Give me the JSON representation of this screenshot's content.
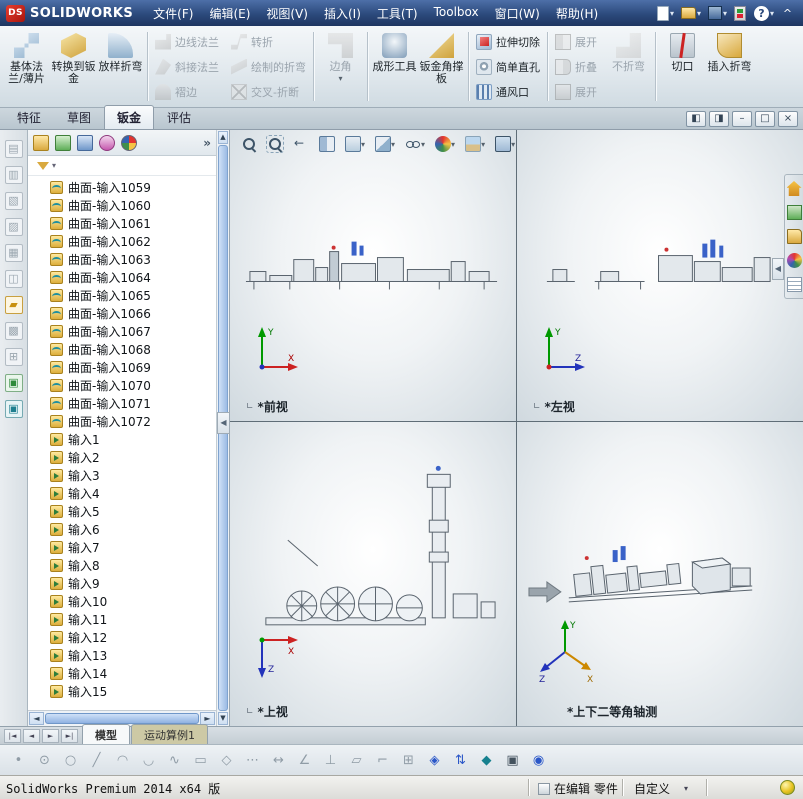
{
  "titlebar": {
    "logo_mark": "DS",
    "logo_text": "SOLIDWORKS",
    "menus": [
      {
        "label": "文件(F)"
      },
      {
        "label": "编辑(E)"
      },
      {
        "label": "视图(V)"
      },
      {
        "label": "插入(I)"
      },
      {
        "label": "工具(T)"
      },
      {
        "label": "Toolbox"
      },
      {
        "label": "窗口(W)"
      },
      {
        "label": "帮助(H)"
      }
    ],
    "tools": [
      {
        "name": "new-document-icon",
        "caret": "▾"
      },
      {
        "name": "open-folder-icon",
        "caret": "▾"
      },
      {
        "name": "save-icon",
        "caret": "▾"
      },
      {
        "name": "rebuild-icon",
        "caret": ""
      },
      {
        "name": "help-icon",
        "caret": "▾"
      },
      {
        "name": "expand-icon",
        "caret": ""
      }
    ]
  },
  "ribbon": {
    "groups": [
      {
        "items": [
          {
            "label": "基体法兰/薄片",
            "name": "base-flange-button",
            "icon": "base-flange-icon",
            "state": "enabled",
            "caret": ""
          },
          {
            "label": "转换到钣金",
            "name": "convert-to-sheetmetal-button",
            "icon": "convert-sheetmetal-icon",
            "state": "enabled",
            "caret": ""
          },
          {
            "label": "放样折弯",
            "name": "lofted-bend-button",
            "icon": "lofted-bend-icon",
            "state": "enabled",
            "caret": ""
          }
        ]
      },
      {
        "items": [
          {
            "label": "边线法兰",
            "name": "edge-flange-button",
            "icon": "edge-flange-icon",
            "state": "disabled",
            "caret": ""
          },
          {
            "label": "斜接法兰",
            "name": "miter-flange-button",
            "icon": "miter-flange-icon",
            "state": "disabled",
            "caret": ""
          },
          {
            "label": "褶边",
            "name": "hem-button",
            "icon": "hem-icon",
            "state": "disabled",
            "caret": ""
          }
        ]
      },
      {
        "items": [
          {
            "label": "转折",
            "name": "jog-button",
            "icon": "jog-icon",
            "state": "disabled",
            "caret": ""
          },
          {
            "label": "绘制的折弯",
            "name": "sketched-bend-button",
            "icon": "sketched-bend-icon",
            "state": "disabled",
            "caret": ""
          },
          {
            "label": "交叉-折断",
            "name": "cross-break-button",
            "icon": "cross-break-icon",
            "state": "disabled",
            "caret": ""
          }
        ]
      },
      {
        "items": [
          {
            "label": "边角",
            "name": "corner-button",
            "icon": "corner-icon",
            "state": "disabled",
            "caret": "▾"
          }
        ]
      },
      {
        "items": [
          {
            "label": "成形工具",
            "name": "forming-tool-button",
            "icon": "forming-tool-icon",
            "state": "enabled",
            "caret": ""
          },
          {
            "label": "钣金角撑板",
            "name": "sheetmetal-gusset-button",
            "icon": "gusset-icon",
            "state": "enabled",
            "caret": ""
          }
        ]
      },
      {
        "items": [
          {
            "label": "拉伸切除",
            "name": "extruded-cut-button",
            "icon": "extruded-cut-icon",
            "state": "enabled",
            "caret": ""
          },
          {
            "label": "简单直孔",
            "name": "simple-hole-button",
            "icon": "simple-hole-icon",
            "state": "enabled",
            "caret": ""
          },
          {
            "label": "通风口",
            "name": "vent-button",
            "icon": "vent-icon",
            "state": "enabled",
            "caret": ""
          }
        ]
      },
      {
        "items": [
          {
            "label": "展开",
            "name": "unfold-button",
            "icon": "unfold-icon",
            "state": "disabled",
            "caret": ""
          },
          {
            "label": "折叠",
            "name": "fold-button",
            "icon": "fold-icon",
            "state": "disabled",
            "caret": ""
          },
          {
            "label": "展开",
            "name": "flatten-button",
            "icon": "flatten-icon",
            "state": "disabled",
            "caret": ""
          }
        ]
      },
      {
        "items": [
          {
            "label": "不折弯",
            "name": "no-bends-button",
            "icon": "no-bends-icon",
            "state": "disabled",
            "caret": ""
          }
        ]
      },
      {
        "items": [
          {
            "label": "切口",
            "name": "rip-button",
            "icon": "rip-icon",
            "state": "enabled",
            "caret": ""
          },
          {
            "label": "插入折弯",
            "name": "insert-bends-button",
            "icon": "insert-bends-icon",
            "state": "enabled",
            "caret": ""
          }
        ]
      }
    ]
  },
  "command_tabs": [
    {
      "label": "特征",
      "state": "",
      "name": "tab-features"
    },
    {
      "label": "草图",
      "state": "",
      "name": "tab-sketch"
    },
    {
      "label": "钣金",
      "state": "active",
      "name": "tab-sheet-metal"
    },
    {
      "label": "评估",
      "state": "",
      "name": "tab-evaluate"
    }
  ],
  "window_controls": [
    {
      "name": "viewport-pane-left-button",
      "glyph": "◧"
    },
    {
      "name": "viewport-pane-right-button",
      "glyph": "◨"
    },
    {
      "name": "minimize-button",
      "glyph": "–"
    },
    {
      "name": "restore-button",
      "glyph": "□"
    },
    {
      "name": "close-button",
      "glyph": "×"
    }
  ],
  "left_toolbar": [
    {
      "name": "left-tool-icon",
      "glyph": "▤",
      "state": ""
    },
    {
      "name": "left-tool-icon",
      "glyph": "▥",
      "state": ""
    },
    {
      "name": "left-tool-icon",
      "glyph": "▧",
      "state": ""
    },
    {
      "name": "left-tool-icon",
      "glyph": "▨",
      "state": ""
    },
    {
      "name": "left-tool-icon",
      "glyph": "▦",
      "state": ""
    },
    {
      "name": "left-tool-icon",
      "glyph": "◫",
      "state": ""
    },
    {
      "name": "pencil-tool-icon",
      "glyph": "▰",
      "state": "accent-gold"
    },
    {
      "name": "left-tool-icon",
      "glyph": "▩",
      "state": ""
    },
    {
      "name": "left-tool-icon",
      "glyph": "⊞",
      "state": ""
    },
    {
      "name": "left-tool-icon",
      "glyph": "▣",
      "state": "accent-green"
    },
    {
      "name": "left-tool-icon",
      "glyph": "▣",
      "state": "accent-teal"
    }
  ],
  "tree": {
    "toolbar": [
      {
        "name": "featuremanager-tab-icon"
      },
      {
        "name": "propertymanager-tab-icon"
      },
      {
        "name": "configurationmanager-tab-icon"
      },
      {
        "name": "dimxpert-tab-icon"
      },
      {
        "name": "displaymanager-tab-icon"
      }
    ],
    "chevron": "»",
    "filter_caret": "▾",
    "items": [
      {
        "label": "曲面-输入1059",
        "icon": "surface-import-icon"
      },
      {
        "label": "曲面-输入1060",
        "icon": "surface-import-icon"
      },
      {
        "label": "曲面-输入1061",
        "icon": "surface-import-icon"
      },
      {
        "label": "曲面-输入1062",
        "icon": "surface-import-icon"
      },
      {
        "label": "曲面-输入1063",
        "icon": "surface-import-icon"
      },
      {
        "label": "曲面-输入1064",
        "icon": "surface-import-icon"
      },
      {
        "label": "曲面-输入1065",
        "icon": "surface-import-icon"
      },
      {
        "label": "曲面-输入1066",
        "icon": "surface-import-icon"
      },
      {
        "label": "曲面-输入1067",
        "icon": "surface-import-icon"
      },
      {
        "label": "曲面-输入1068",
        "icon": "surface-import-icon"
      },
      {
        "label": "曲面-输入1069",
        "icon": "surface-import-icon"
      },
      {
        "label": "曲面-输入1070",
        "icon": "surface-import-icon"
      },
      {
        "label": "曲面-输入1071",
        "icon": "surface-import-icon"
      },
      {
        "label": "曲面-输入1072",
        "icon": "surface-import-icon"
      },
      {
        "label": "输入1",
        "icon": "import-icon"
      },
      {
        "label": "输入2",
        "icon": "import-icon"
      },
      {
        "label": "输入3",
        "icon": "import-icon"
      },
      {
        "label": "输入4",
        "icon": "import-icon"
      },
      {
        "label": "输入5",
        "icon": "import-icon"
      },
      {
        "label": "输入6",
        "icon": "import-icon"
      },
      {
        "label": "输入7",
        "icon": "import-icon"
      },
      {
        "label": "输入8",
        "icon": "import-icon"
      },
      {
        "label": "输入9",
        "icon": "import-icon"
      },
      {
        "label": "输入10",
        "icon": "import-icon"
      },
      {
        "label": "输入11",
        "icon": "import-icon"
      },
      {
        "label": "输入12",
        "icon": "import-icon"
      },
      {
        "label": "输入13",
        "icon": "import-icon"
      },
      {
        "label": "输入14",
        "icon": "import-icon"
      },
      {
        "label": "输入15",
        "icon": "import-icon"
      }
    ]
  },
  "viewport_toolbar": [
    {
      "name": "zoom-fit-icon",
      "caret": ""
    },
    {
      "name": "zoom-area-icon",
      "caret": ""
    },
    {
      "name": "previous-view-icon",
      "caret": ""
    },
    {
      "name": "section-view-icon",
      "caret": ""
    },
    {
      "name": "view-orientation-icon",
      "caret": "▾"
    },
    {
      "name": "display-style-icon",
      "caret": "▾"
    },
    {
      "name": "hide-show-items-icon",
      "caret": "▾"
    },
    {
      "name": "edit-appearance-icon",
      "caret": "▾"
    },
    {
      "name": "apply-scene-icon",
      "caret": "▾"
    },
    {
      "name": "view-settings-icon",
      "caret": "▾"
    }
  ],
  "viewports": [
    {
      "name": "front-viewport",
      "label": "*前视",
      "origin_glyph": "∟",
      "ax_v": "Y",
      "ax_h": "X"
    },
    {
      "name": "left-viewport",
      "label": "*左视",
      "origin_glyph": "∟",
      "ax_v": "Y",
      "ax_h": "Z"
    },
    {
      "name": "top-viewport",
      "label": "*上视",
      "origin_glyph": "∟",
      "ax_h": "X",
      "ax_d": "Z"
    },
    {
      "name": "isometric-viewport",
      "label": "*上下二等角轴测",
      "origin_glyph": "",
      "ax_v": "Y",
      "ax_l": "Z",
      "ax_r": "X"
    }
  ],
  "task_pane": [
    {
      "name": "solidworks-resources-icon"
    },
    {
      "name": "design-library-icon"
    },
    {
      "name": "file-explorer-icon"
    },
    {
      "name": "appearances-icon"
    },
    {
      "name": "custom-properties-icon"
    }
  ],
  "task_pane_arrow": "◀",
  "panel_collapse_arrow": "◀",
  "document_tabs": {
    "nav": [
      {
        "name": "scroll-first-button",
        "glyph": "|◄"
      },
      {
        "name": "scroll-prev-button",
        "glyph": "◄"
      },
      {
        "name": "scroll-next-button",
        "glyph": "►"
      },
      {
        "name": "scroll-last-button",
        "glyph": "►|"
      }
    ],
    "tabs": [
      {
        "label": "模型",
        "state": "active",
        "name": "tab-model"
      },
      {
        "label": "运动算例1",
        "state": "",
        "name": "tab-motion-study-1"
      }
    ]
  },
  "sketch_toolbar": [
    {
      "name": "select-icon",
      "glyph": "•",
      "state": ""
    },
    {
      "name": "smart-dimension-icon",
      "glyph": "⊙",
      "state": ""
    },
    {
      "name": "circle-icon",
      "glyph": "○",
      "state": ""
    },
    {
      "name": "line-icon",
      "glyph": "╱",
      "state": ""
    },
    {
      "name": "ellipse-icon",
      "glyph": "◠",
      "state": ""
    },
    {
      "name": "arc-icon",
      "glyph": "◡",
      "state": ""
    },
    {
      "name": "spline-icon",
      "glyph": "∿",
      "state": ""
    },
    {
      "name": "rectangle-icon",
      "glyph": "▭",
      "state": ""
    },
    {
      "name": "polygon-icon",
      "glyph": "◇",
      "state": ""
    },
    {
      "name": "point-icon",
      "glyph": "⋯",
      "state": ""
    },
    {
      "name": "mirror-icon",
      "glyph": "↔",
      "state": ""
    },
    {
      "name": "angle-icon",
      "glyph": "∠",
      "state": ""
    },
    {
      "name": "perpendicular-icon",
      "glyph": "⊥",
      "state": ""
    },
    {
      "name": "parallelogram-icon",
      "glyph": "▱",
      "state": ""
    },
    {
      "name": "trim-icon",
      "glyph": "⌐",
      "state": ""
    },
    {
      "name": "grid-icon",
      "glyph": "⊞",
      "state": ""
    },
    {
      "name": "isometric-cube-icon",
      "glyph": "◈",
      "state": "accent-blue"
    },
    {
      "name": "updown-arrows-icon",
      "glyph": "⇅",
      "state": "accent-blue"
    },
    {
      "name": "shaded-view-icon",
      "glyph": "◆",
      "state": "accent-teal"
    },
    {
      "name": "screen-icon",
      "glyph": "▣",
      "state": "accent-dark"
    },
    {
      "name": "sphere-icon",
      "glyph": "◉",
      "state": "accent-blue"
    }
  ],
  "statusbar": {
    "left_text": "SolidWorks Premium 2014 x64 版",
    "editing_label": "在编辑 零件",
    "custom_label": "自定义",
    "custom_caret": "▾"
  }
}
